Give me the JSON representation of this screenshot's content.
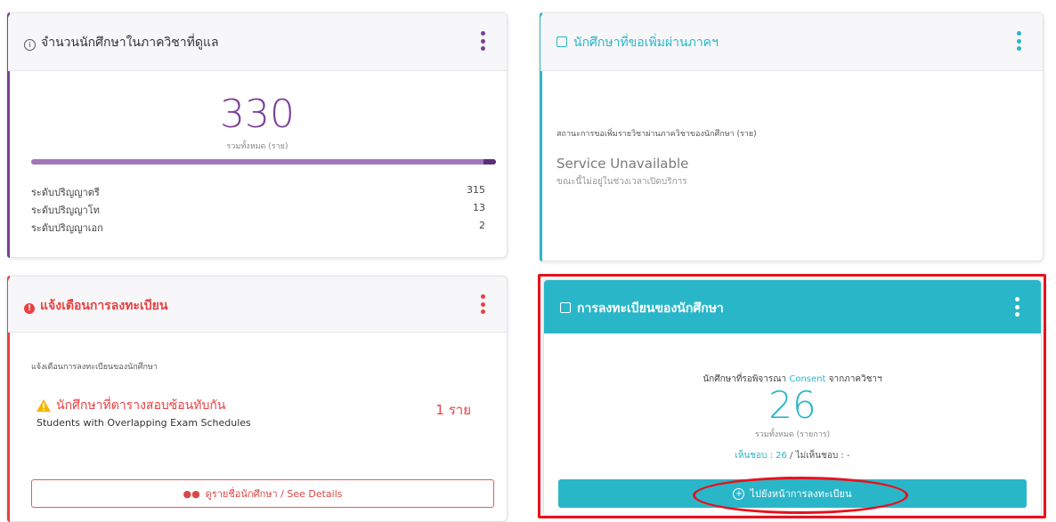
{
  "colors": {
    "purple": "#7b3f98",
    "teal": "#2ab6c9",
    "red": "#e84141"
  },
  "card_students": {
    "title": "จำนวนนักศึกษาในภาควิชาที่ดูแล",
    "icon": "info-circle-icon",
    "total": "330",
    "total_label": "รวมทั้งหมด (ราย)",
    "progress": 1.0,
    "rows": [
      {
        "label": "ระดับปริญญาตรี",
        "value": "315"
      },
      {
        "label": "ระดับปริญญาโท",
        "value": "13"
      },
      {
        "label": "ระดับปริญญาเอก",
        "value": "2"
      }
    ]
  },
  "card_requests": {
    "title": "นักศึกษาที่ขอเพิ่มผ่านภาคฯ",
    "icon": "edit-icon",
    "message": "สถานะการขอเพิ่มรายวิชาผ่านภาควิชาของนักศึกษา (ราย)",
    "status": "Service Unavailable",
    "status_sub": "ขณะนี้ไม่อยู่ในช่วงเวลาเปิดบริการ"
  },
  "card_warning": {
    "title": "แจ้งเตือนการลงทะเบียน",
    "icon": "exclamation-circle-icon",
    "message": "แจ้งเตือนการลงทะเบียนของนักศึกษา",
    "warning_th": "นักศึกษาที่ตารางสอบซ้อนทับกัน",
    "warning_en": "Students with Overlapping Exam Schedules",
    "count": "1 ราย",
    "button_label": "ดูรายชื่อนักศึกษา / See Details",
    "button_icon": "users-icon"
  },
  "card_registration": {
    "title": "การลงทะเบียนของนักศึกษา",
    "icon": "edit-icon",
    "line1_prefix": "นักศึกษาที่รอพิจารณา",
    "line1_highlight": "Consent",
    "line1_suffix": "จากภาควิชาฯ",
    "total": "26",
    "total_label": "รวมทั้งหมด (รายการ)",
    "approved_label": "เห็นชอบ : 26",
    "separator": "/",
    "rejected_label": "ไม่เห็นชอบ : -",
    "button_label": "ไปยังหน้าการลงทะเบียน",
    "button_icon": "plus-circle-icon"
  }
}
